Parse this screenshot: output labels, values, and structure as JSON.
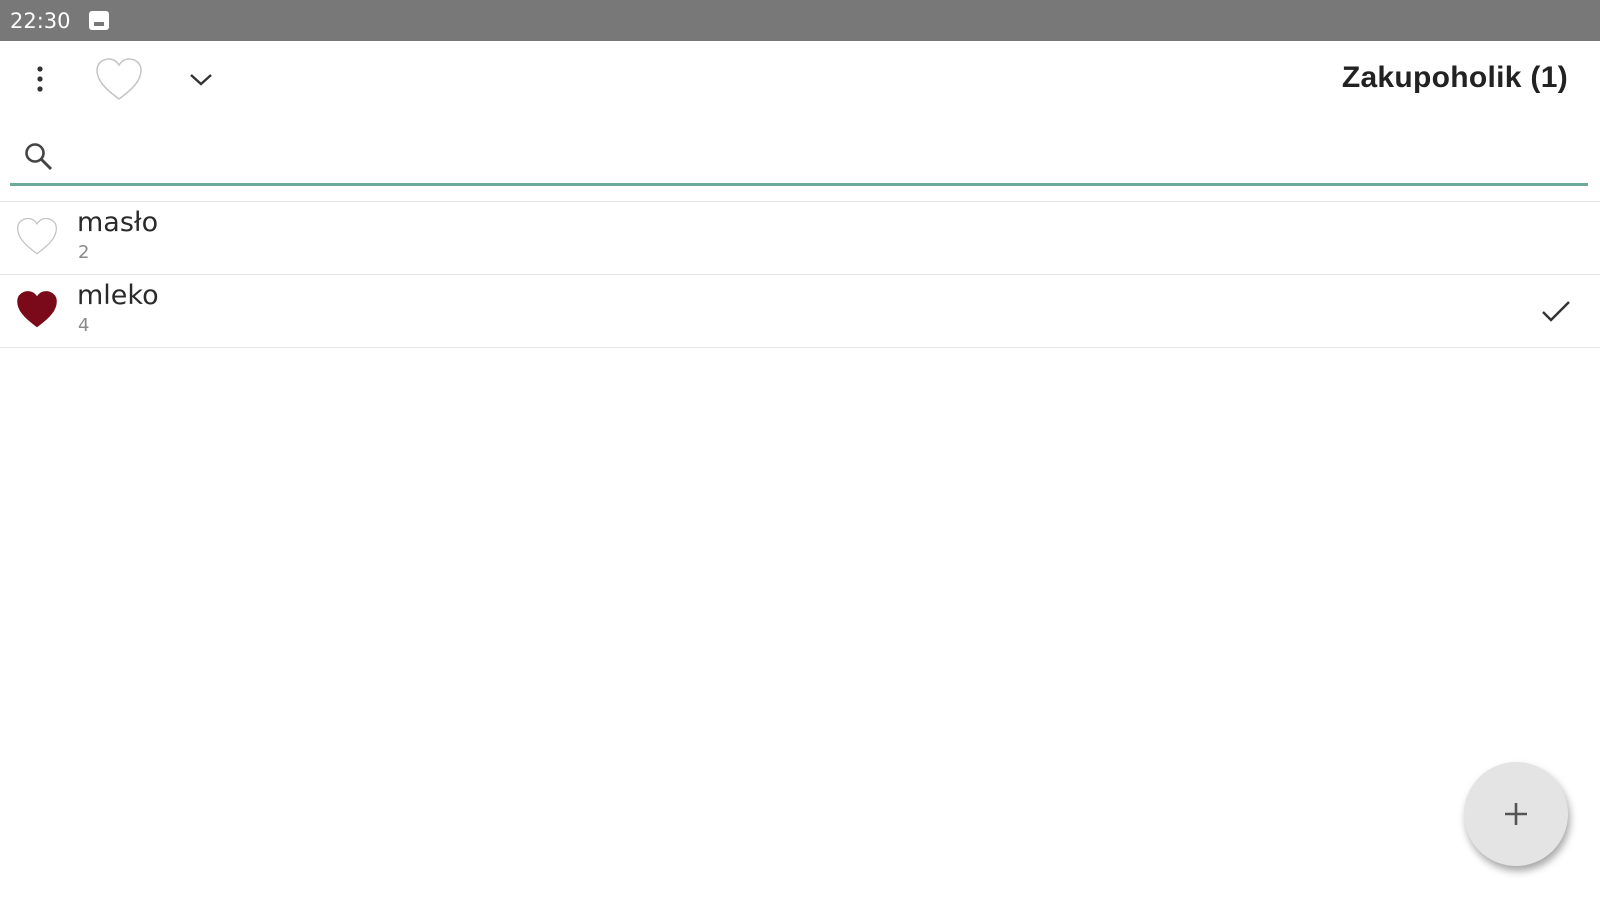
{
  "status_bar": {
    "time": "22:30",
    "notification_icon": "image-notification-icon",
    "background_color": "#787878"
  },
  "toolbar": {
    "menu_icon": "more-vert-icon",
    "favorite_icon": "heart-outline-icon",
    "dropdown_icon": "chevron-down-icon",
    "title": "Zakupoholik (1)"
  },
  "search": {
    "icon": "search-icon",
    "value": "",
    "placeholder": "",
    "underline_color": "#6eaa9c"
  },
  "items": [
    {
      "name": "masło",
      "quantity": "2",
      "favorite": false,
      "checked": false
    },
    {
      "name": "mleko",
      "quantity": "4",
      "favorite": true,
      "checked": true
    }
  ],
  "colors": {
    "heart_filled": "#7a0a1a",
    "heart_outline": "#bdbdbd",
    "fab_background": "#e4e4e4"
  },
  "fab": {
    "icon": "plus-icon"
  }
}
